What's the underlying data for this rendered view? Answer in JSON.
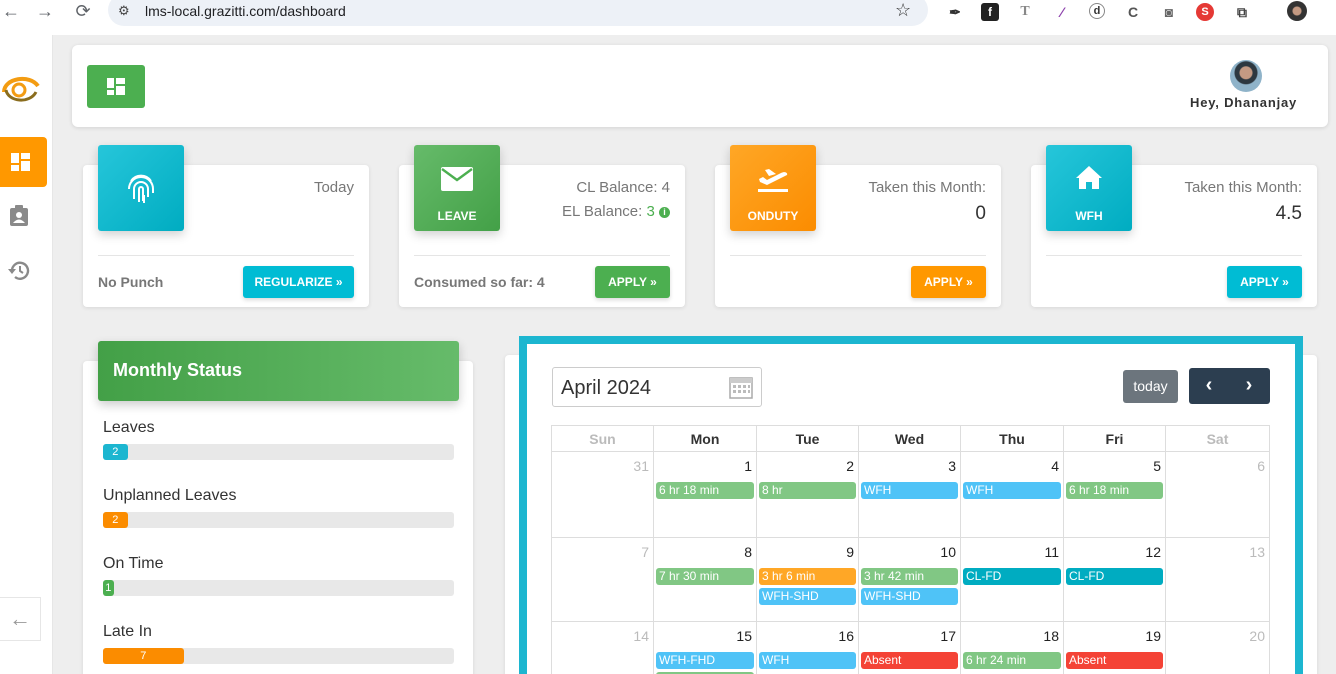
{
  "browser": {
    "url": "lms-local.grazitti.com/dashboard",
    "nav_icons": [
      "back-icon",
      "forward-icon",
      "reload-icon"
    ],
    "extensions": [
      "eyedropper-icon",
      "fontface-icon",
      "text-icon",
      "feather-icon",
      "d-icon",
      "c-icon",
      "camera-icon",
      "s-icon",
      "puzzle-icon",
      "profile-icon"
    ]
  },
  "sidebar": {
    "items": [
      {
        "icon": "dashboard-icon",
        "active": true
      },
      {
        "icon": "clipboard-user-icon",
        "active": false
      },
      {
        "icon": "history-icon",
        "active": false
      }
    ],
    "collapse_icon": "arrow-left-icon"
  },
  "header": {
    "greeting": "Hey, Dhananjay",
    "menu_icon": "dashboard-icon"
  },
  "cards": [
    {
      "icon": "fingerprint-icon",
      "label": "",
      "line1": "Today",
      "line2": "",
      "footer": "No Punch",
      "button": "REGULARIZE »",
      "color": "#26c6da"
    },
    {
      "icon": "envelope-icon",
      "label": "LEAVE",
      "line1": "CL Balance: 4",
      "line2_label": "EL Balance:",
      "line2_value": "3",
      "footer": "Consumed so far: 4",
      "button": "APPLY »",
      "color": "#4caf50"
    },
    {
      "icon": "plane-departure-icon",
      "label": "ONDUTY",
      "line1": "Taken this Month:",
      "value": "0",
      "footer": "",
      "button": "APPLY »",
      "color": "#ff9800"
    },
    {
      "icon": "home-icon",
      "label": "WFH",
      "line1": "Taken this Month:",
      "value": "4.5",
      "footer": "",
      "button": "APPLY »",
      "color": "#26c6da"
    }
  ],
  "monthly_status": {
    "title": "Monthly Status",
    "items": [
      {
        "label": "Leaves",
        "value": "2",
        "fraction": 0.07,
        "color": "#1cb6d0"
      },
      {
        "label": "Unplanned Leaves",
        "value": "2",
        "fraction": 0.07,
        "color": "#fb8c00"
      },
      {
        "label": "On Time",
        "value": "1",
        "fraction": 0.03,
        "color": "#4caf50"
      },
      {
        "label": "Late In",
        "value": "7",
        "fraction": 0.23,
        "color": "#fb8c00"
      }
    ]
  },
  "calendar": {
    "month": "April 2024",
    "today_label": "today",
    "prev_icon": "chevron-left-icon",
    "next_icon": "chevron-right-icon",
    "calendar_icon": "calendar-icon",
    "days": [
      "Sun",
      "Mon",
      "Tue",
      "Wed",
      "Thu",
      "Fri",
      "Sat"
    ],
    "weeks": [
      {
        "dates": [
          "31",
          "1",
          "2",
          "3",
          "4",
          "5",
          "6"
        ],
        "off": [
          true,
          false,
          false,
          false,
          false,
          false,
          true
        ],
        "events": [
          [],
          [
            {
              "t": "6 hr 18 min",
              "c": "#81c784"
            }
          ],
          [
            {
              "t": "8 hr",
              "c": "#81c784"
            }
          ],
          [
            {
              "t": "WFH",
              "c": "#4fc3f7"
            }
          ],
          [
            {
              "t": "WFH",
              "c": "#4fc3f7"
            }
          ],
          [
            {
              "t": "6 hr 18 min",
              "c": "#81c784"
            }
          ],
          []
        ]
      },
      {
        "dates": [
          "7",
          "8",
          "9",
          "10",
          "11",
          "12",
          "13"
        ],
        "off": [
          true,
          false,
          false,
          false,
          false,
          false,
          true
        ],
        "events": [
          [],
          [
            {
              "t": "7 hr 30 min",
              "c": "#81c784"
            }
          ],
          [
            {
              "t": "3 hr 6 min",
              "c": "#ffa726"
            },
            {
              "t": "WFH-SHD",
              "c": "#4fc3f7"
            }
          ],
          [
            {
              "t": "3 hr 42 min",
              "c": "#81c784"
            },
            {
              "t": "WFH-SHD",
              "c": "#4fc3f7"
            }
          ],
          [
            {
              "t": "CL-FD",
              "c": "#00acc1"
            }
          ],
          [
            {
              "t": "CL-FD",
              "c": "#00acc1"
            }
          ],
          []
        ]
      },
      {
        "dates": [
          "14",
          "15",
          "16",
          "17",
          "18",
          "19",
          "20"
        ],
        "off": [
          true,
          false,
          false,
          false,
          false,
          false,
          true
        ],
        "events": [
          [],
          [
            {
              "t": "WFH-FHD",
              "c": "#4fc3f7"
            },
            {
              "t": "",
              "c": "#81c784"
            }
          ],
          [
            {
              "t": "WFH",
              "c": "#4fc3f7"
            }
          ],
          [
            {
              "t": "Absent",
              "c": "#f44336"
            }
          ],
          [
            {
              "t": "6 hr 24 min",
              "c": "#81c784"
            }
          ],
          [
            {
              "t": "Absent",
              "c": "#f44336"
            }
          ],
          []
        ]
      }
    ]
  }
}
